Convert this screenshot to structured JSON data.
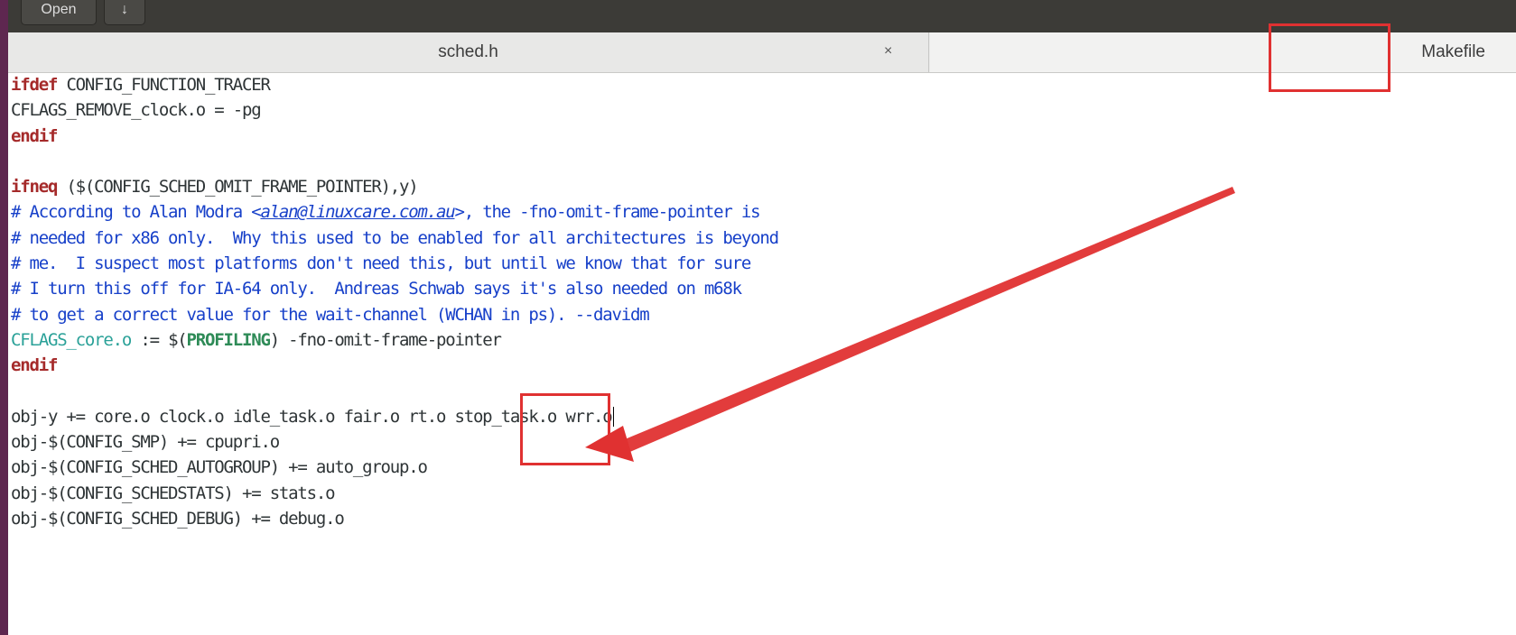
{
  "toolbar": {
    "open_label": "Open",
    "save_label": "↓"
  },
  "tabs": {
    "sched_label": "sched.h",
    "sched_close": "×",
    "makefile_label": "Makefile"
  },
  "code": {
    "l1_kw": "ifdef",
    "l1_rest": " CONFIG_FUNCTION_TRACER",
    "l2": "CFLAGS_REMOVE_clock.o = -pg",
    "l3_kw": "endif",
    "l5_kw": "ifneq",
    "l5_rest": " ($(CONFIG_SCHED_OMIT_FRAME_POINTER),y)",
    "l6_pre": "# According to Alan Modra <",
    "l6_email": "alan@linuxcare.com.au",
    "l6_post": ">, the -fno-omit-frame-pointer is",
    "l7": "# needed for x86 only.  Why this used to be enabled for all architectures is beyond",
    "l8": "# me.  I suspect most platforms don't need this, but until we know that for sure",
    "l9": "# I turn this off for IA-64 only.  Andreas Schwab says it's also needed on m68k",
    "l10": "# to get a correct value for the wait-channel (WCHAN in ps). --davidm",
    "l11_var": "CFLAGS_core.o",
    "l11_mid": " := $(",
    "l11_bold": "PROFILING",
    "l11_post": ") -fno-omit-frame-pointer",
    "l12_kw": "endif",
    "l14": "obj-y += core.o clock.o idle_task.o fair.o rt.o stop_task.o wrr.o",
    "l15": "obj-$(CONFIG_SMP) += cpupri.o",
    "l16": "obj-$(CONFIG_SCHED_AUTOGROUP) += auto_group.o",
    "l17": "obj-$(CONFIG_SCHEDSTATS) += stats.o",
    "l18": "obj-$(CONFIG_SCHED_DEBUG) += debug.o"
  },
  "colors": {
    "keyword": "#a52a2a",
    "comment": "#1740c9",
    "annotation": "#e03131"
  }
}
